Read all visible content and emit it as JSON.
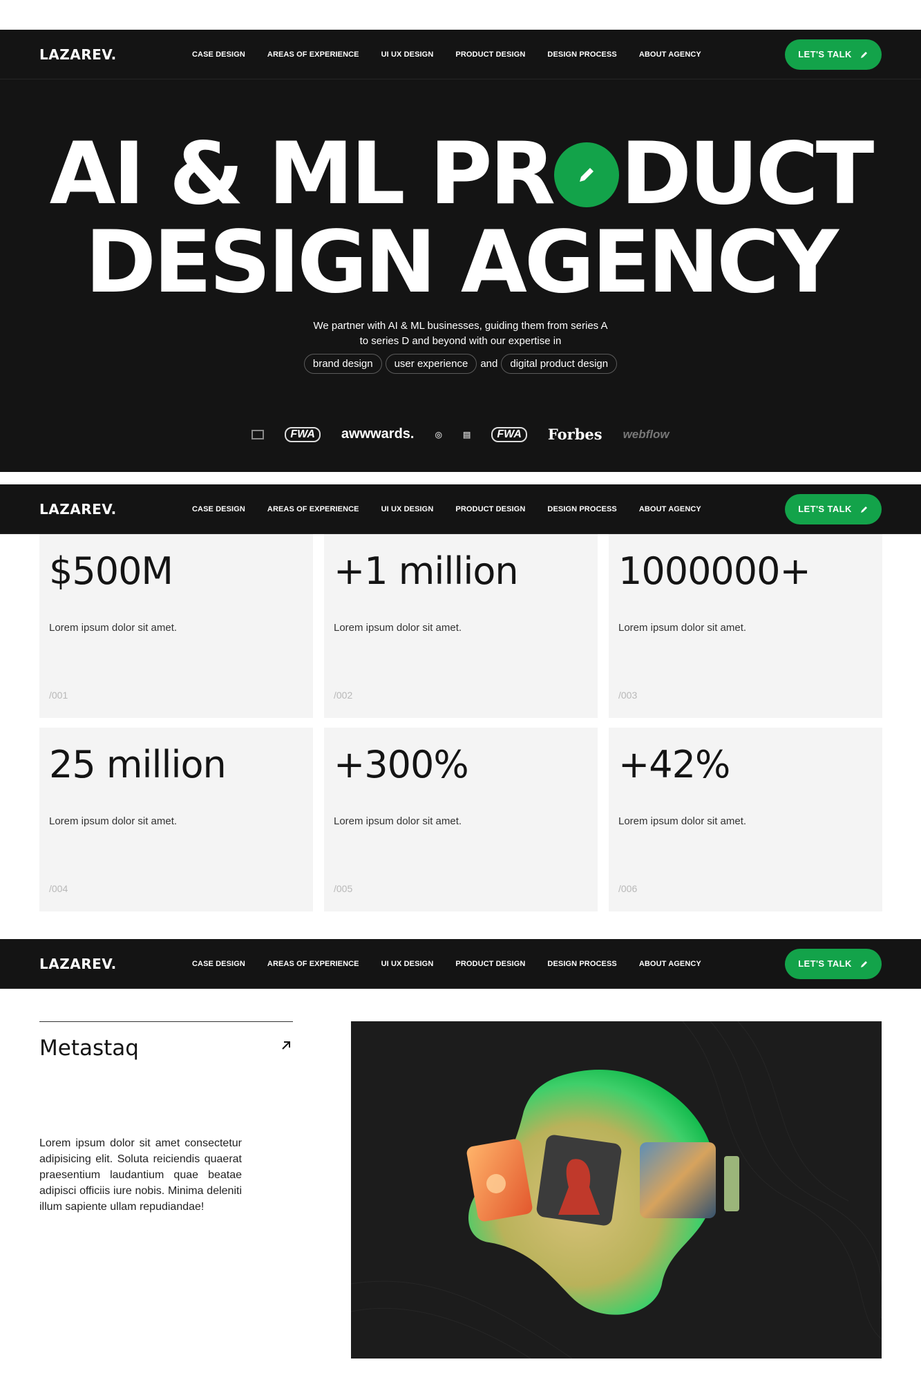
{
  "nav": {
    "logo": "LAZAREV.",
    "menu": [
      "CASE DESIGN",
      "AREAS OF EXPERIENCE",
      "UI UX DESIGN",
      "PRODUCT DESIGN",
      "DESIGN PROCESS",
      "ABOUT AGENCY"
    ],
    "cta_label": "LET'S TALK",
    "cta_icon": "pencil-icon"
  },
  "hero": {
    "title_line1_a": "AI & ML PR",
    "title_line1_b": "DUCT",
    "title_line2": "DESIGN AGENCY",
    "title_badge_icon": "pencil-icon",
    "subtitle_line1": "We partner with AI & ML businesses, guiding them from series A",
    "subtitle_line2": "to series D and beyond with our expertise in",
    "pills": [
      "brand design",
      "user experience",
      "digital product design"
    ],
    "pill_connector": "and",
    "logos": [
      "awwwards.",
      "Forbes",
      "webflow"
    ]
  },
  "stats": [
    {
      "value": "$500M",
      "desc": "Lorem ipsum dolor sit amet.",
      "index": "/001"
    },
    {
      "value": "+1 million",
      "desc": "Lorem ipsum dolor sit amet.",
      "index": "/002"
    },
    {
      "value": "1000000+",
      "desc": "Lorem ipsum dolor sit amet.",
      "index": "/003"
    },
    {
      "value": "25 million",
      "desc": "Lorem ipsum dolor sit amet.",
      "index": "/004"
    },
    {
      "value": "+300%",
      "desc": "Lorem ipsum dolor sit amet.",
      "index": "/005"
    },
    {
      "value": "+42%",
      "desc": "Lorem ipsum dolor sit amet.",
      "index": "/006"
    }
  ],
  "case": {
    "title": "Metastaq",
    "arrow_icon": "arrow-up-right-icon",
    "text": "Lorem ipsum dolor sit amet consectetur adipisicing elit. Soluta reiciendis quaerat praesentium laudantium quae beatae adipisci officiis iure nobis. Minima deleniti illum sapiente ullam repudiandae!"
  },
  "colors": {
    "accent": "#13a34a",
    "dark": "#141414",
    "card": "#f4f4f4"
  }
}
